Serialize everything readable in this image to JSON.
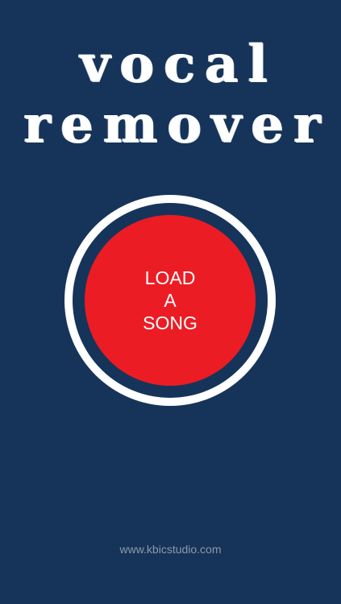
{
  "app": {
    "logo_line1": "vocal",
    "logo_line2": "remover"
  },
  "load_button": {
    "line1": "LOAD",
    "line2": "A",
    "line3": "SONG"
  },
  "footer": {
    "website": "www.kbicstudio.com"
  },
  "colors": {
    "background": "#163459",
    "ring": "#ffffff",
    "button": "#ec1c24",
    "footer_text": "#8d99a9"
  }
}
